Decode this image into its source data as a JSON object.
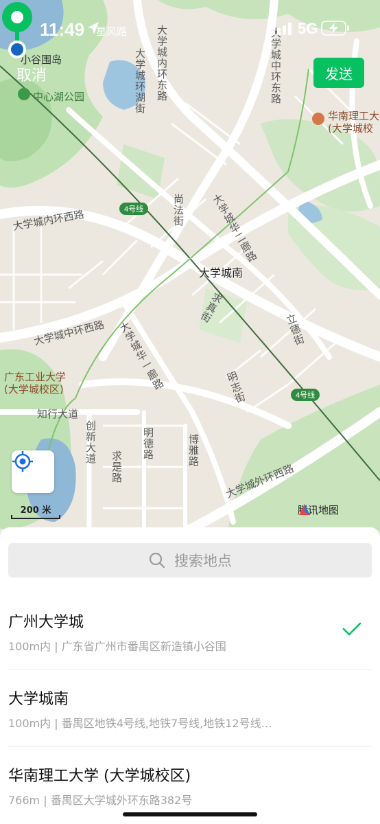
{
  "status_bar": {
    "time": "11:49",
    "network": "5G",
    "icons": [
      "location-arrow-icon",
      "signal-icon",
      "battery-charging-icon"
    ]
  },
  "header": {
    "cancel_label": "取消",
    "send_label": "发送"
  },
  "map": {
    "labels": {
      "xiaoguwei": "小谷围岛",
      "xingfeng": "星风路",
      "park": "中心湖公园",
      "inner_ring_east": "大学城内环东路",
      "ring_lake": "大学城环湖街",
      "middle_ring_east": "大学城中环东路",
      "scut_name": "华南理工大",
      "scut_campus": "(大学城校",
      "inner_ring_west": "大学城内环西路",
      "shangfa": "尚法街",
      "huaer": "大学城华二廊路",
      "qiuzhen": "求真街",
      "lide": "立德街",
      "middle_ring_west": "大学城中环西路",
      "huayi": "大学城华一廊路",
      "gdut_name": "广东工业大学",
      "gdut_campus": "(大学城校区)",
      "mingzhi": "明志街",
      "zhixing": "知行大道",
      "chuangxin": "创新大道",
      "qiushi": "求是路",
      "mingde": "明德路",
      "boya": "博雅路",
      "outer_ring_west": "大学城外环西路",
      "metro_line": "4号线",
      "pin_label": "大学城南"
    },
    "scale_label": "200 米",
    "logo_text": "腾讯地图"
  },
  "search": {
    "placeholder": "搜索地点"
  },
  "results": [
    {
      "title": "广州大学城",
      "subtitle": "100m内 | 广东省广州市番禺区新造镇小谷围",
      "selected": true
    },
    {
      "title": "大学城南",
      "subtitle": "100m内 | 番禺区地铁4号线,地铁7号线,地铁12号线…",
      "selected": false
    },
    {
      "title": "华南理工大学 (大学城校区)",
      "subtitle": "766m | 番禺区大学城外环东路382号",
      "selected": false
    }
  ],
  "colors": {
    "accent_green": "#07c160",
    "metro_green": "#2e8b3f",
    "locate_blue": "#1a6fe0",
    "pin_green": "#07c160",
    "pin_dot_blue": "#1565c0"
  }
}
